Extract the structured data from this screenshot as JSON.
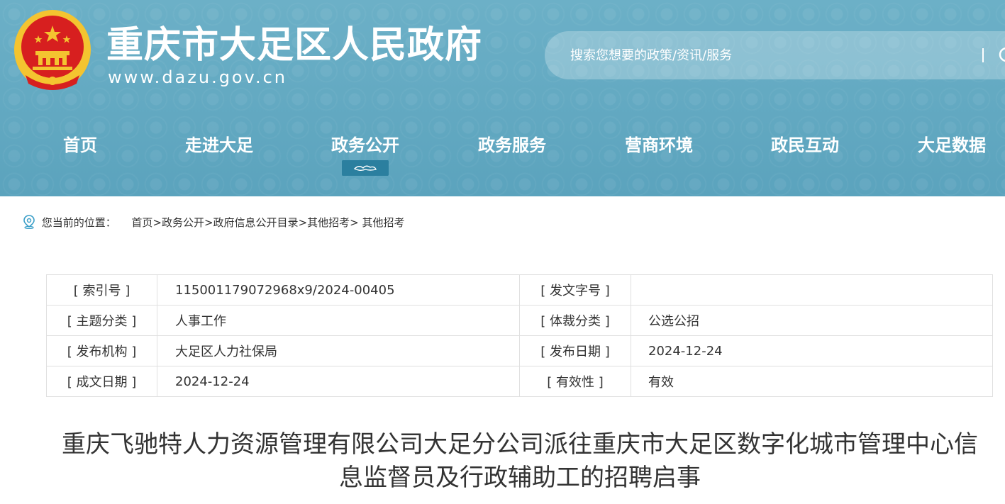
{
  "header": {
    "site_title": "重庆市大足区人民政府",
    "site_url": "www.dazu.gov.cn",
    "search_placeholder": "搜索您想要的政策/资讯/服务",
    "colors": {
      "header_bg": "#5fa6bf",
      "active_mark": "#2b7f9f",
      "emblem_red": "#d71f1f",
      "emblem_gold": "#f4c430"
    }
  },
  "nav": {
    "items": [
      {
        "label": "首页"
      },
      {
        "label": "走进大足"
      },
      {
        "label": "政务公开",
        "active": true
      },
      {
        "label": "政务服务"
      },
      {
        "label": "营商环境"
      },
      {
        "label": "政民互动"
      },
      {
        "label": "大足数据"
      }
    ]
  },
  "breadcrumb": {
    "prefix": "您当前的位置：",
    "items": [
      "首页",
      "政务公开",
      "政府信息公开目录",
      "其他招考",
      "其他招考"
    ],
    "separators": [
      ">",
      ">",
      ">",
      "> "
    ]
  },
  "meta": {
    "rows": [
      {
        "l1": "[ 索引号 ]",
        "v1": "115001179072968x9/2024-00405",
        "l2": "[ 发文字号 ]",
        "v2": ""
      },
      {
        "l1": "[ 主题分类 ]",
        "v1": "人事工作",
        "l2": "[ 体裁分类 ]",
        "v2": "公选公招"
      },
      {
        "l1": "[ 发布机构 ]",
        "v1": "大足区人力社保局",
        "l2": "[ 发布日期 ]",
        "v2": "2024-12-24"
      },
      {
        "l1": "[ 成文日期 ]",
        "v1": "2024-12-24",
        "l2": "[ 有效性 ]",
        "v2": "有效"
      }
    ]
  },
  "article": {
    "title_line1": "重庆飞驰特人力资源管理有限公司大足分公司派往重庆市大足区数字化城市管理中心信",
    "title_line2": "息监督员及行政辅助工的招聘启事"
  }
}
